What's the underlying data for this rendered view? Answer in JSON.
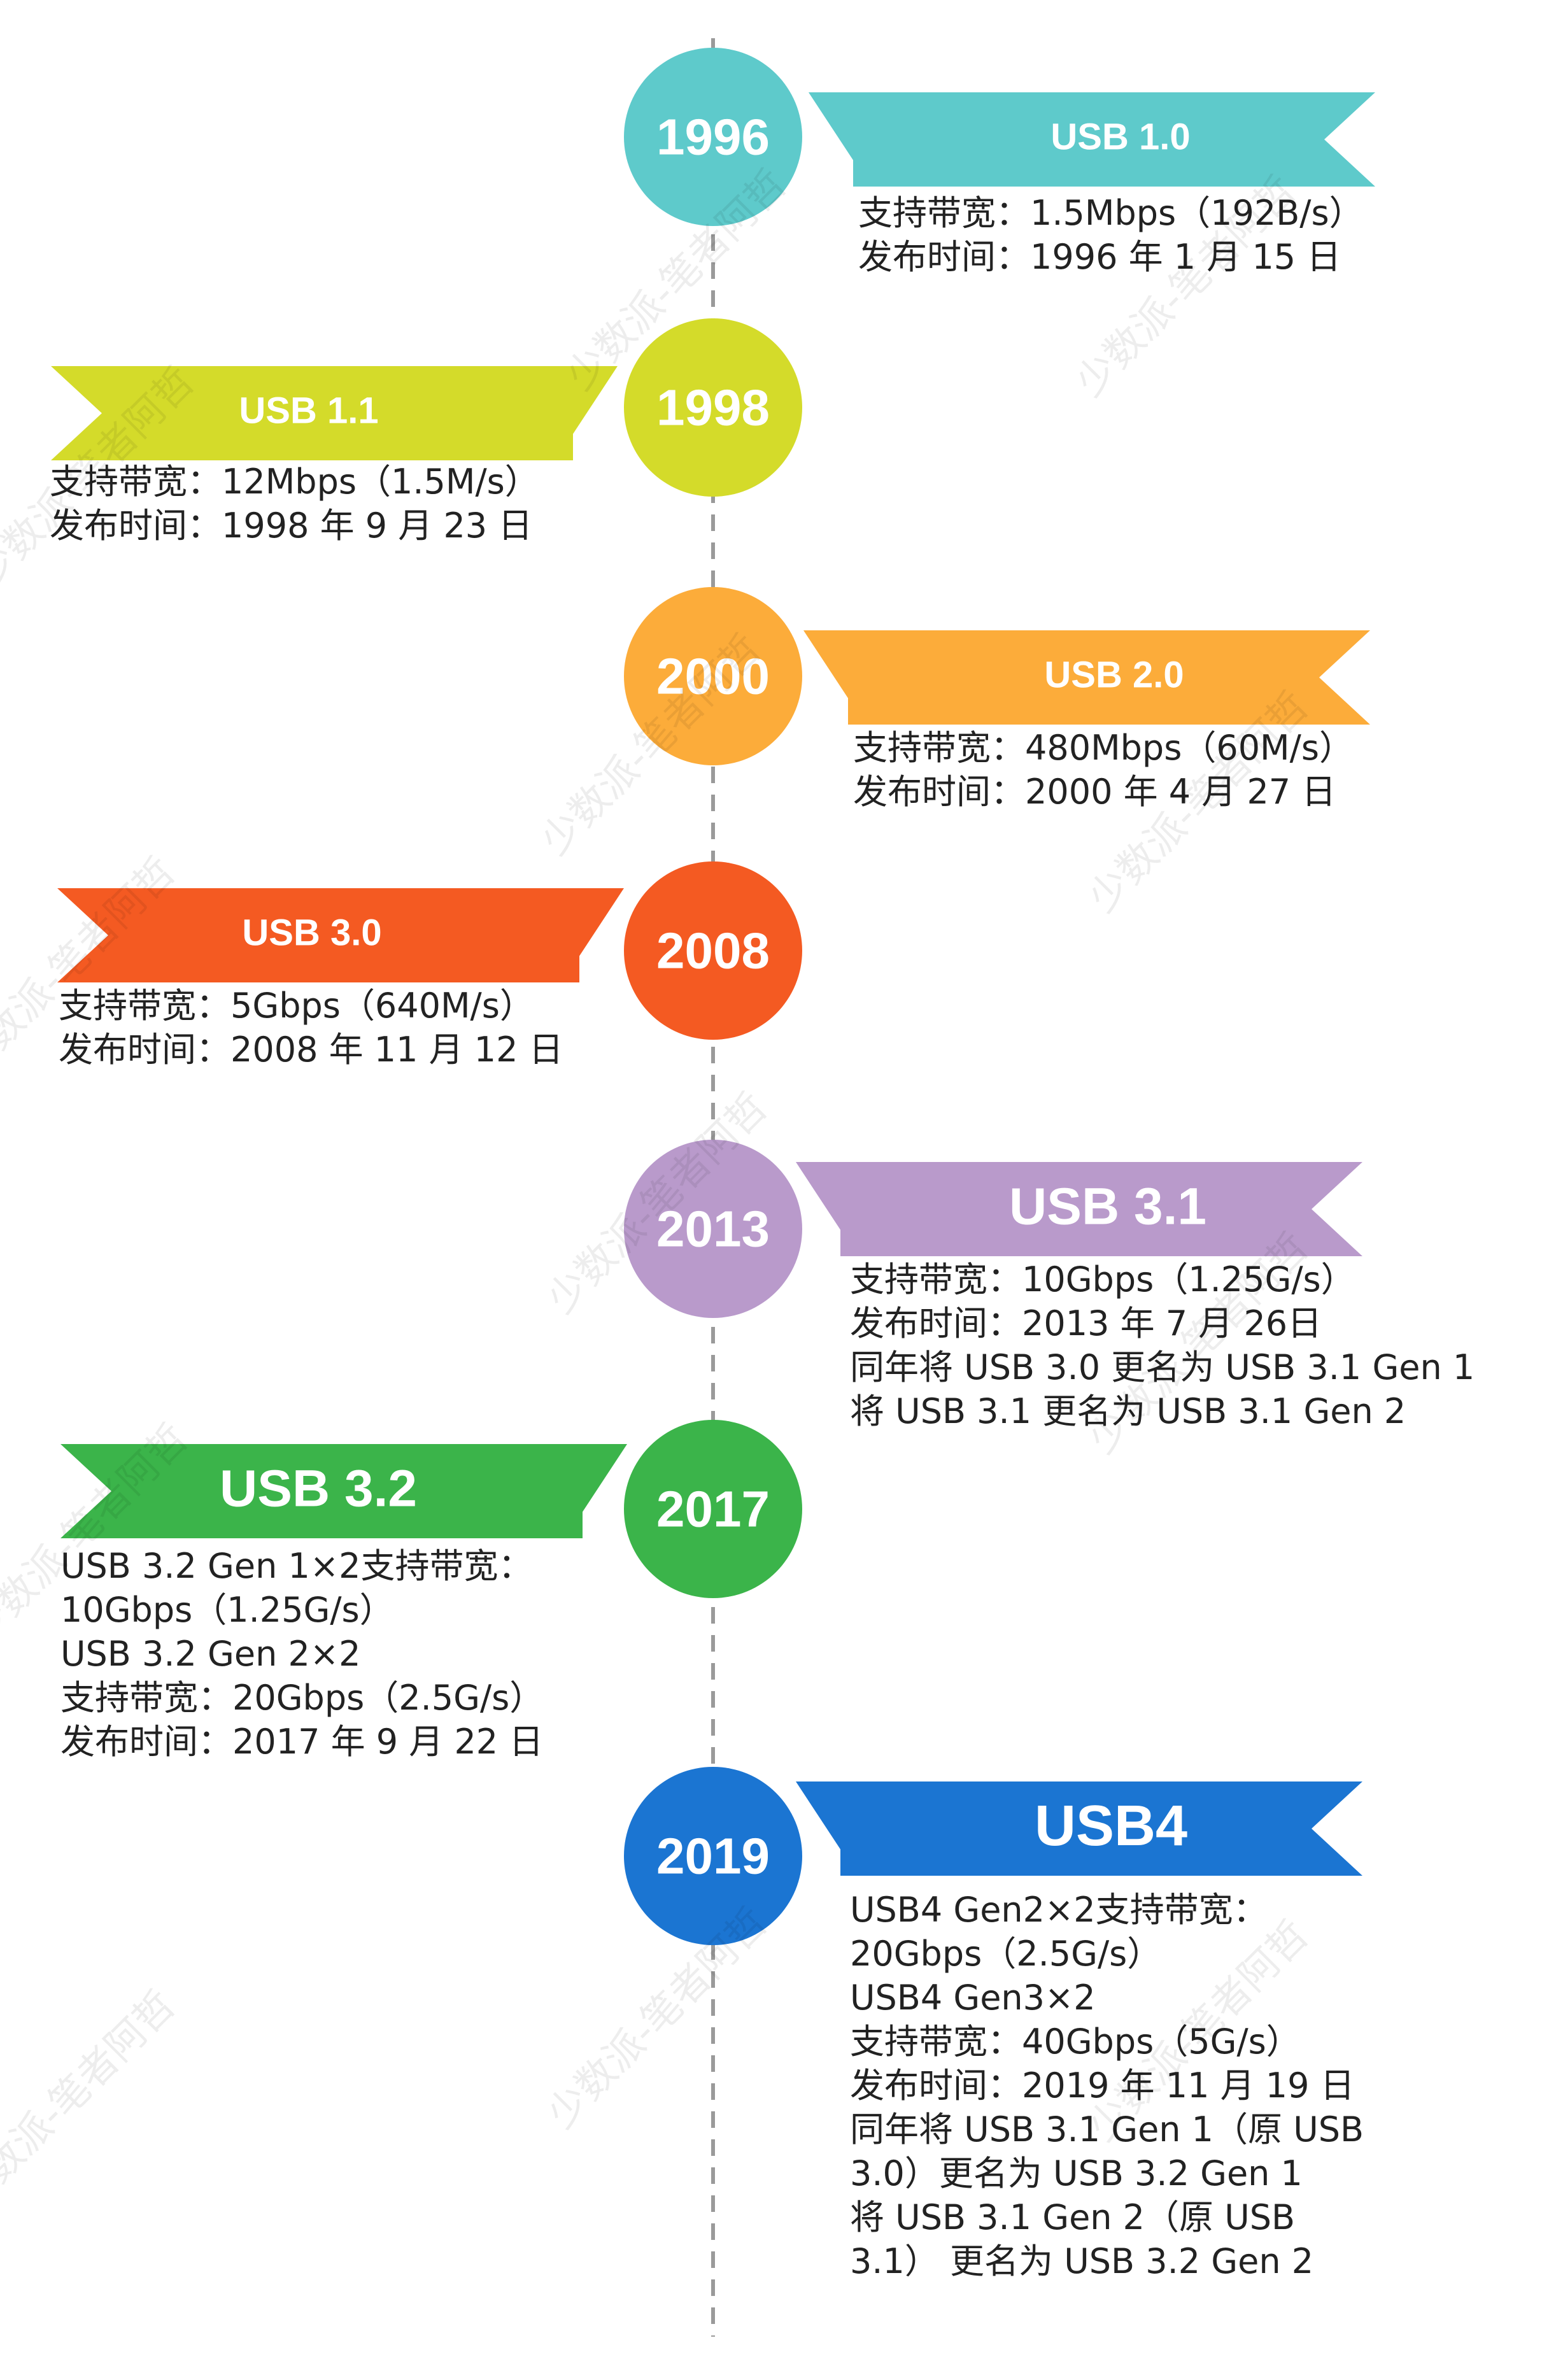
{
  "watermark_text": "少数派-笔者阿哲",
  "events": [
    {
      "year": "1996",
      "color": "#5ECACB",
      "side": "right",
      "ribbon_label": "USB 1.0",
      "lines": [
        "支持带宽：1.5Mbps（192B/s）",
        "发布时间：1996 年 1 月 15 日"
      ]
    },
    {
      "year": "1998",
      "color": "#D4DB2A",
      "side": "left",
      "ribbon_label": "USB 1.1",
      "lines": [
        "支持带宽：12Mbps（1.5M/s）",
        "发布时间：1998 年 9 月 23 日"
      ]
    },
    {
      "year": "2000",
      "color": "#FCAC3A",
      "side": "right",
      "ribbon_label": "USB 2.0",
      "lines": [
        "支持带宽：480Mbps（60M/s）",
        "发布时间：2000 年 4 月 27 日"
      ]
    },
    {
      "year": "2008",
      "color": "#F45A22",
      "side": "left",
      "ribbon_label": "USB 3.0",
      "lines": [
        "支持带宽：5Gbps（640M/s）",
        "发布时间：2008 年 11 月 12 日"
      ]
    },
    {
      "year": "2013",
      "color": "#B99ACB",
      "side": "right",
      "ribbon_label": "USB 3.1",
      "lines": [
        "支持带宽：10Gbps（1.25G/s）",
        "发布时间：2013 年 7 月 26日",
        "同年将 USB 3.0 更名为 USB 3.1 Gen 1",
        "将 USB 3.1 更名为 USB 3.1 Gen 2"
      ]
    },
    {
      "year": "2017",
      "color": "#3BB44A",
      "side": "left",
      "ribbon_label": "USB 3.2",
      "lines": [
        "USB 3.2 Gen 1×2支持带宽：",
        "10Gbps（1.25G/s）",
        "USB 3.2 Gen 2×2",
        "支持带宽：20Gbps（2.5G/s）",
        "发布时间：2017 年 9 月 22 日"
      ]
    },
    {
      "year": "2019",
      "color": "#1B75D2",
      "side": "right",
      "ribbon_label": "USB4",
      "lines": [
        "USB4 Gen2×2支持带宽：",
        "20Gbps（2.5G/s）",
        "USB4 Gen3×2",
        "支持带宽：40Gbps（5G/s）",
        "发布时间：2019 年 11 月 19 日",
        "同年将 USB 3.1 Gen 1（原 USB",
        "3.0）更名为 USB 3.2 Gen 1",
        "将 USB 3.1 Gen 2（原 USB",
        "3.1） 更名为 USB 3.2 Gen 2"
      ]
    }
  ]
}
